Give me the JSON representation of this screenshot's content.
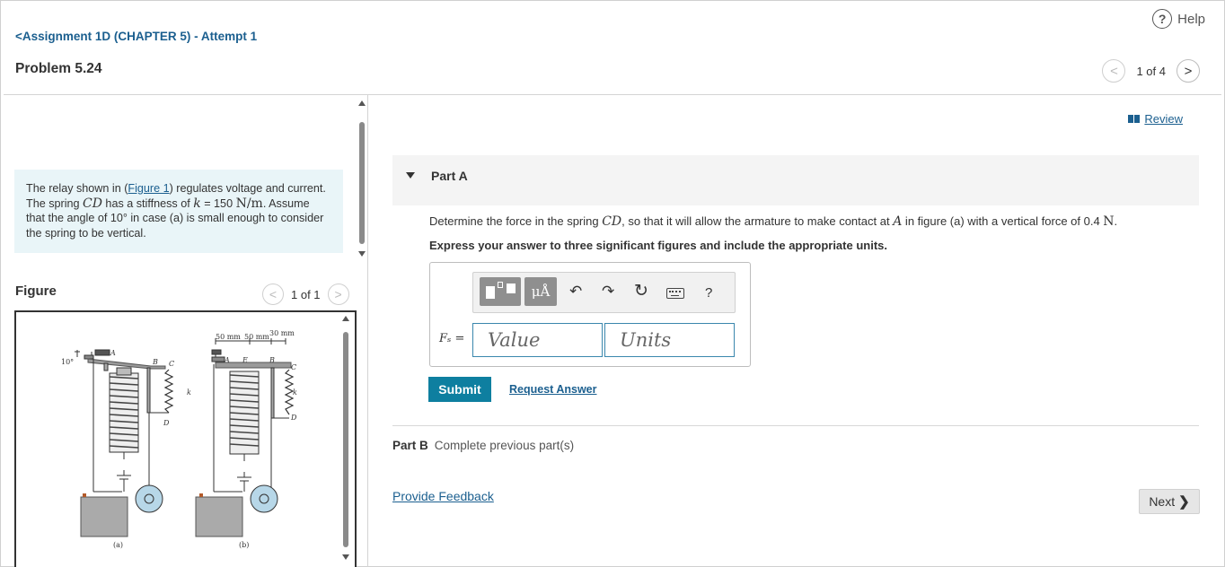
{
  "header": {
    "help_label": "Help",
    "help_symbol": "?",
    "assignment_link": "Assignment 1D (CHAPTER 5) - Attempt 1",
    "assignment_chevron": "<",
    "problem_title": "Problem 5.24",
    "pager_text": "1 of 4",
    "prev_symbol": "<",
    "next_symbol": ">"
  },
  "intro": {
    "text_before_link": "The relay shown in (",
    "figure_link": "Figure 1",
    "text_after_link": ") regulates voltage and current. The spring ",
    "spring_name": "CD",
    "stiffness_text": " has a stiffness of ",
    "k_symbol": "k",
    "k_value": " = 150 ",
    "k_units": "N/m",
    "assumption": ". Assume that the angle of 10° in case (a) is small enough to consider the spring to be vertical."
  },
  "figure": {
    "label": "Figure",
    "pager_text": "1 of 1",
    "prev_symbol": "<",
    "next_symbol": ">",
    "labels": {
      "angle": "10°",
      "point_a": "A",
      "point_b": "B",
      "point_c": "C",
      "point_d": "D",
      "point_e": "E",
      "spring_k": "k",
      "dim_50a": "50 mm",
      "dim_50b": "50 mm",
      "dim_30": "30 mm",
      "caption_a": "(a)",
      "caption_b": "(b)"
    }
  },
  "review": {
    "label": "Review"
  },
  "partA": {
    "title": "Part A",
    "question_before": "Determine the force in the spring ",
    "spring": "CD",
    "question_middle": ", so that it will allow the armature to make contact at ",
    "point": "A",
    "question_after": " in figure (a) with a vertical force of 0.4 ",
    "force_unit": "N",
    "question_end": ".",
    "instruction": "Express your answer to three significant figures and include the appropriate units.",
    "toolbar": {
      "mu_label": "μÅ",
      "undo_symbol": "↶",
      "redo_symbol": "↷",
      "reset_symbol": "↻",
      "help_symbol": "?"
    },
    "variable_label": "Fₛ =",
    "value_placeholder": "Value",
    "units_placeholder": "Units",
    "submit_label": "Submit",
    "request_label": "Request Answer"
  },
  "partB": {
    "title": "Part B",
    "description": "Complete previous part(s)"
  },
  "footer": {
    "feedback_label": "Provide Feedback",
    "next_label": "Next",
    "next_symbol": "❯"
  }
}
